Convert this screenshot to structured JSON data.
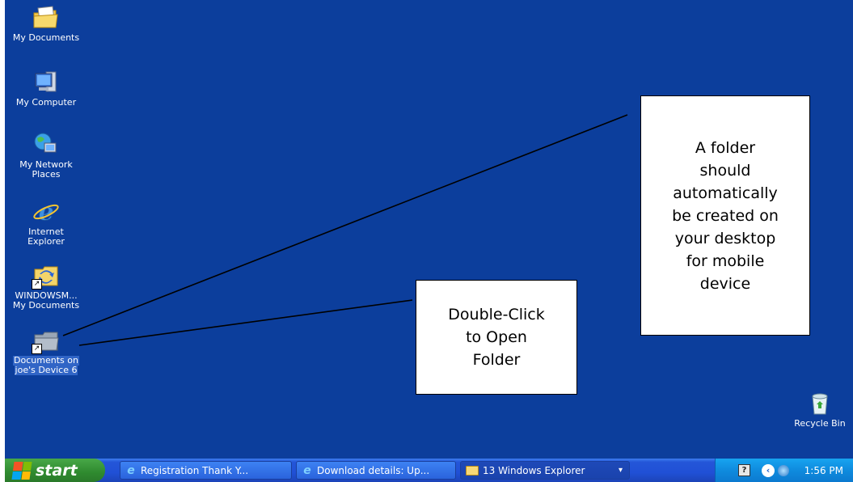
{
  "desktop_icons": [
    {
      "label_line1": "My Documents",
      "label_line2": "",
      "icon": "my-documents-folder-icon"
    },
    {
      "label_line1": "My Computer",
      "label_line2": "",
      "icon": "my-computer-icon"
    },
    {
      "label_line1": "My Network",
      "label_line2": "Places",
      "icon": "network-places-icon"
    },
    {
      "label_line1": "Internet",
      "label_line2": "Explorer",
      "icon": "internet-explorer-icon"
    },
    {
      "label_line1": "WINDOWSM...",
      "label_line2": "My Documents",
      "icon": "sync-folder-shortcut-icon"
    },
    {
      "label_line1": "Documents on",
      "label_line2": "joe's Device 6",
      "icon": "folder-shortcut-icon"
    },
    {
      "label_line1": "Recycle Bin",
      "label_line2": "",
      "icon": "recycle-bin-icon"
    }
  ],
  "callouts": {
    "double_click": [
      "Double-Click",
      "to Open",
      "Folder"
    ],
    "folder_created": [
      "A folder",
      "should",
      "automatically",
      "be created on",
      "your desktop",
      "for mobile",
      "device"
    ]
  },
  "taskbar": {
    "start_label": "start",
    "tasks": [
      {
        "label": "Registration Thank Y...",
        "icon": "internet-explorer-icon"
      },
      {
        "label": "Download details: Up...",
        "icon": "internet-explorer-icon"
      },
      {
        "label": "13 Windows Explorer",
        "icon": "folder-icon",
        "arrow": "▾"
      }
    ],
    "clock": "1:56 PM"
  },
  "colors": {
    "desktop": "#0c3e9c",
    "taskbar": "#2456d8",
    "start": "#3a9a3a",
    "tray": "#0f8bde"
  }
}
